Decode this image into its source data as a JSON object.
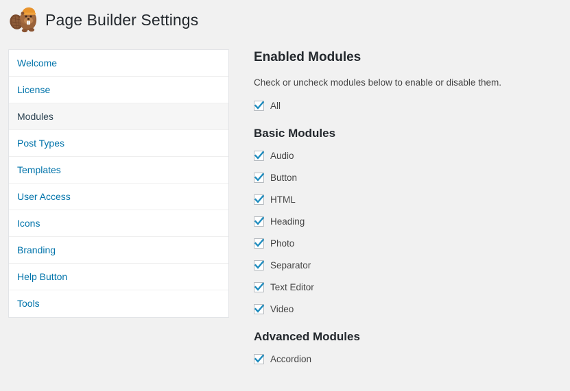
{
  "header": {
    "title": "Page Builder Settings",
    "logo_icon": "beaver-mascot-icon"
  },
  "sidebar": {
    "items": [
      {
        "label": "Welcome",
        "active": false
      },
      {
        "label": "License",
        "active": false
      },
      {
        "label": "Modules",
        "active": true
      },
      {
        "label": "Post Types",
        "active": false
      },
      {
        "label": "Templates",
        "active": false
      },
      {
        "label": "User Access",
        "active": false
      },
      {
        "label": "Icons",
        "active": false
      },
      {
        "label": "Branding",
        "active": false
      },
      {
        "label": "Help Button",
        "active": false
      },
      {
        "label": "Tools",
        "active": false
      }
    ]
  },
  "main": {
    "heading": "Enabled Modules",
    "description": "Check or uncheck modules below to enable or disable them.",
    "all_toggle": {
      "label": "All",
      "checked": true
    },
    "groups": [
      {
        "heading": "Basic Modules",
        "modules": [
          {
            "label": "Audio",
            "checked": true
          },
          {
            "label": "Button",
            "checked": true
          },
          {
            "label": "HTML",
            "checked": true
          },
          {
            "label": "Heading",
            "checked": true
          },
          {
            "label": "Photo",
            "checked": true
          },
          {
            "label": "Separator",
            "checked": true
          },
          {
            "label": "Text Editor",
            "checked": true
          },
          {
            "label": "Video",
            "checked": true
          }
        ]
      },
      {
        "heading": "Advanced Modules",
        "modules": [
          {
            "label": "Accordion",
            "checked": true
          }
        ]
      }
    ]
  },
  "colors": {
    "page_background": "#f1f1f1",
    "panel_background": "#ffffff",
    "link_blue": "#0073aa",
    "active_text": "#2e4453",
    "active_row_background": "#f6f6f6",
    "heading_text": "#23282d",
    "body_text": "#444444",
    "checkbox_border": "#b4b9be",
    "checkmark_blue": "#1e8cbe",
    "logo_brown": "#8a5a3b",
    "logo_hat_orange": "#e8932c"
  }
}
